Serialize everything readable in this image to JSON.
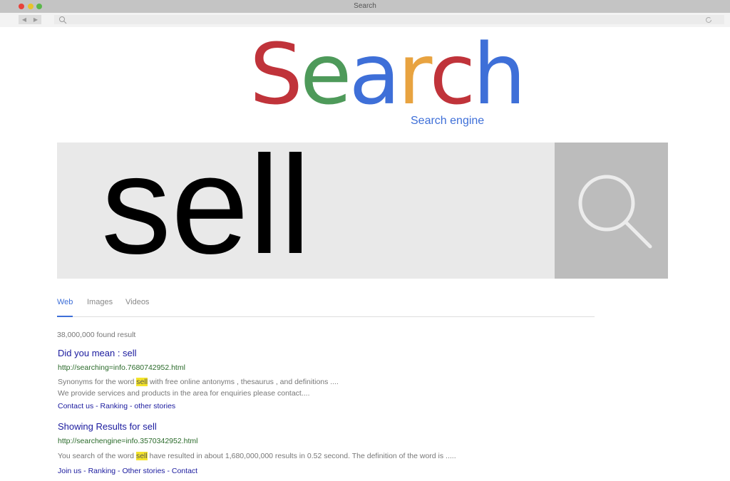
{
  "window": {
    "title": "Search"
  },
  "colors": {
    "red": "#c0333a",
    "green": "#4e9a5a",
    "blue": "#3e6fd8",
    "orange": "#e8a340"
  },
  "logo": {
    "letters": [
      "S",
      "e",
      "a",
      "r",
      "c",
      "h"
    ],
    "subtitle": "Search engine"
  },
  "search": {
    "query": "sell",
    "button_icon": "search-icon"
  },
  "tabs": [
    "Web",
    "Images",
    "Videos"
  ],
  "result_count": "38,000,000 found result",
  "results": [
    {
      "title": "Did you mean : sell",
      "url": "http://searching=info.7680742952.html",
      "desc1_pre": "Synonyms for the word ",
      "desc1_hl": "sell",
      "desc1_post": " with free online antonyms , thesaurus , and definitions ....",
      "desc2": "We provide services and products in the area for enquiries please contact....",
      "links": "Contact us - Ranking - other stories"
    },
    {
      "title": "Showing Results for sell",
      "url": "http://searchengine=info.3570342952.html",
      "desc1_pre": "You search of the word ",
      "desc1_hl": "sell",
      "desc1_post": " have resulted in about 1,680,000,000 results in 0.52 second. The definition of the word is .....",
      "links": "Join us - Ranking - Other stories - Contact"
    }
  ]
}
